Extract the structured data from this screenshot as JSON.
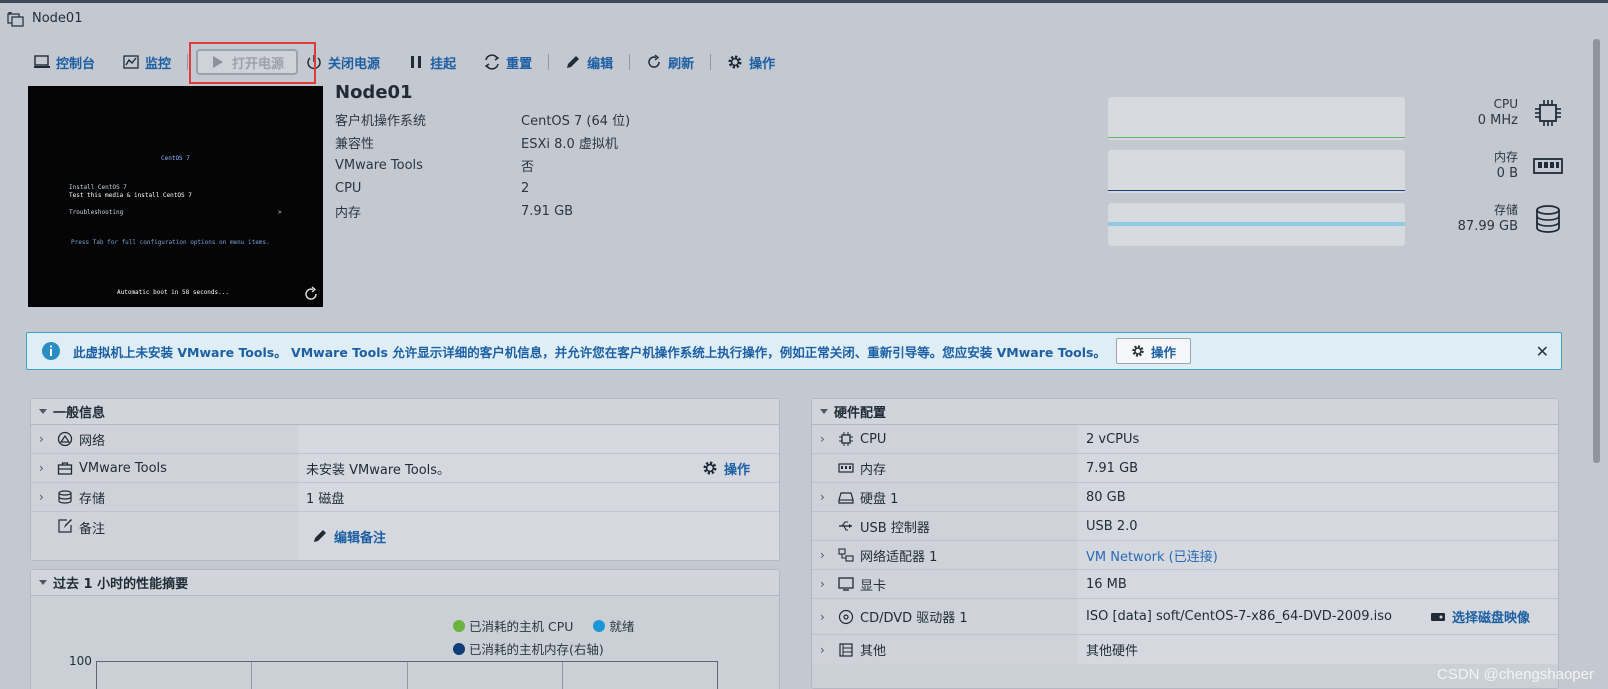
{
  "window": {
    "title": "Node01"
  },
  "toolbar": {
    "console": "控制台",
    "monitor": "监控",
    "power_on": "打开电源",
    "power_off": "关闭电源",
    "suspend": "挂起",
    "reset": "重置",
    "edit": "编辑",
    "refresh": "刷新",
    "actions": "操作"
  },
  "console": {
    "lines": [
      "CentOS 7",
      "Install CentOS 7",
      "Test this media & install CentOS 7",
      "Troubleshooting",
      ">",
      "Press Tab for full configuration options on menu items.",
      "Automatic boot in 58 seconds..."
    ]
  },
  "vm": {
    "name": "Node01",
    "props": [
      {
        "k": "客户机操作系统",
        "v": "CentOS 7 (64 位)"
      },
      {
        "k": "兼容性",
        "v": "ESXi 8.0 虚拟机"
      },
      {
        "k": "VMware Tools",
        "v": "否"
      },
      {
        "k": "CPU",
        "v": "2"
      },
      {
        "k": "内存",
        "v": "7.91 GB"
      }
    ]
  },
  "meters": [
    {
      "label": "CPU",
      "value": "0 MHz",
      "icon": "cpu-icon",
      "color": "#5cb85c"
    },
    {
      "label": "内存",
      "value": "0 B",
      "icon": "memory-icon",
      "color": "#1f3f7a"
    },
    {
      "label": "存储",
      "value": "87.99 GB",
      "icon": "storage-icon",
      "color": "#8fcbe6"
    }
  ],
  "banner": {
    "message": "此虚拟机上未安装 VMware Tools。 VMware Tools 允许显示详细的客户机信息，并允许您在客户机操作系统上执行操作，例如正常关闭、重新引导等。您应安装 VMware Tools。",
    "action": "操作"
  },
  "general": {
    "title": "一般信息",
    "rows": [
      {
        "k": "网络",
        "v": ""
      },
      {
        "k": "VMware Tools",
        "v": "未安装 VMware Tools。",
        "action": "操作"
      },
      {
        "k": "存储",
        "v": "1 磁盘"
      },
      {
        "k": "备注",
        "action": "编辑备注"
      }
    ]
  },
  "perf": {
    "title": "过去 1 小时的性能摘要",
    "legend": [
      "已消耗的主机 CPU",
      "就绪",
      "已消耗的主机内存(右轴)"
    ],
    "legend_colors": [
      "#6cb33f",
      "#1b96d6",
      "#103c78"
    ],
    "y_top": "100"
  },
  "hardware": {
    "title": "硬件配置",
    "rows": [
      {
        "k": "CPU",
        "v": "2 vCPUs"
      },
      {
        "k": "内存",
        "v": "7.91 GB"
      },
      {
        "k": "硬盘 1",
        "v": "80 GB"
      },
      {
        "k": "USB 控制器",
        "v": "USB 2.0"
      },
      {
        "k": "网络适配器 1",
        "v": "VM Network (已连接)"
      },
      {
        "k": "显卡",
        "v": "16 MB"
      },
      {
        "k": "CD/DVD 驱动器 1",
        "v": "ISO [data] soft/CentOS-7-x86_64-DVD-2009.iso",
        "action": "选择磁盘映像"
      },
      {
        "k": "其他",
        "v": "其他硬件"
      }
    ]
  },
  "watermark": "CSDN @chengshaoper"
}
